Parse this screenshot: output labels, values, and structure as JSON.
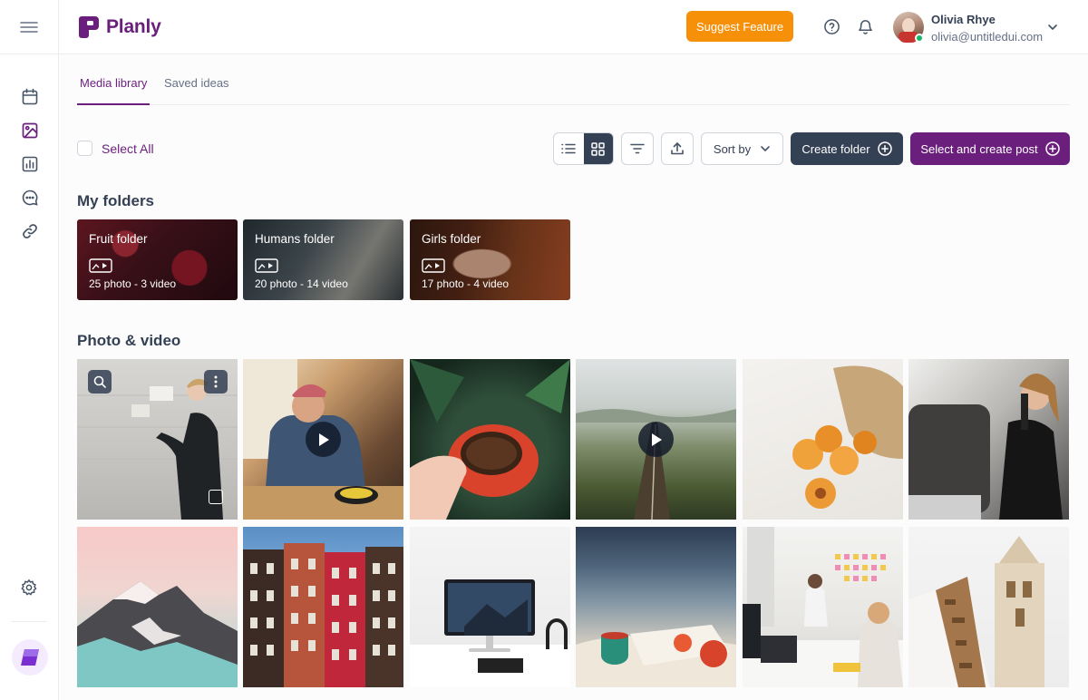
{
  "app": {
    "brand": "Planly"
  },
  "header": {
    "suggest_label": "Suggest Feature",
    "user": {
      "name": "Olivia Rhye",
      "email": "olivia@untitledui.com"
    }
  },
  "tabs": [
    {
      "label": "Media library",
      "active": true
    },
    {
      "label": "Saved ideas",
      "active": false
    }
  ],
  "toolbar": {
    "select_all": "Select All",
    "sort_label": "Sort by",
    "create_folder": "Create folder",
    "create_post": "Select and create post"
  },
  "folders_section": {
    "title": "My folders",
    "items": [
      {
        "name": "Fruit folder",
        "count": "25 photo - 3 video"
      },
      {
        "name": "Humans folder",
        "count": "20 photo - 14 video"
      },
      {
        "name": "Girls folder",
        "count": "17 photo - 4 video"
      }
    ]
  },
  "media_section": {
    "title": "Photo & video",
    "items": [
      {
        "subject": "man-at-wall-photo",
        "video": false
      },
      {
        "subject": "old-man-eating-video",
        "video": true
      },
      {
        "subject": "coffee-cup-photo",
        "video": false
      },
      {
        "subject": "landscape-road-video",
        "video": true
      },
      {
        "subject": "apricots-bag-photo",
        "video": false
      },
      {
        "subject": "woman-laptop-mic-photo",
        "video": false
      },
      {
        "subject": "snowy-mountain-photo",
        "video": false
      },
      {
        "subject": "brick-houses-photo",
        "video": false
      },
      {
        "subject": "desk-monitor-photo",
        "video": false
      },
      {
        "subject": "beach-picnic-photo",
        "video": false
      },
      {
        "subject": "office-meeting-photo",
        "video": false
      },
      {
        "subject": "stone-tower-photo",
        "video": false
      }
    ]
  },
  "colors": {
    "brand": "#6b1f7c",
    "accent_orange": "#f79009",
    "dark_button": "#344054",
    "online": "#12b76a"
  }
}
